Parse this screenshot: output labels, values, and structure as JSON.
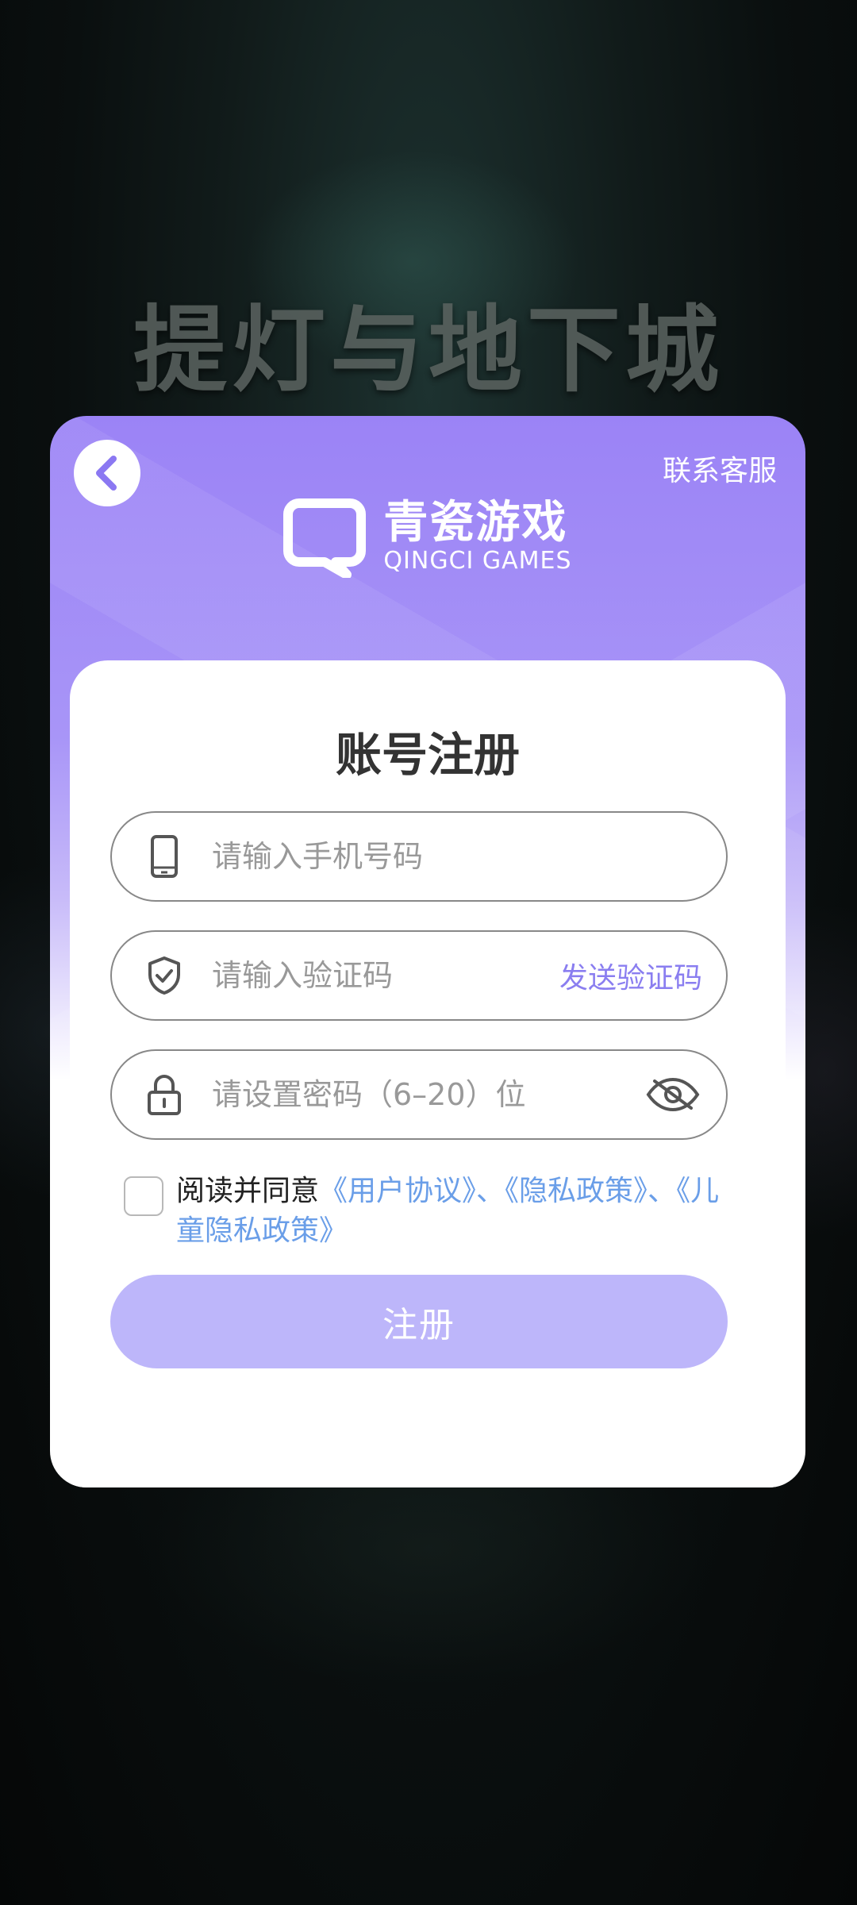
{
  "game_title": "提灯与地下城",
  "header": {
    "support_label": "联系客服",
    "brand_cn": "青瓷游戏",
    "brand_en": "QINGCI GAMES"
  },
  "form": {
    "title": "账号注册",
    "phone": {
      "placeholder": "请输入手机号码",
      "value": ""
    },
    "code": {
      "placeholder": "请输入验证码",
      "value": "",
      "send_label": "发送验证码"
    },
    "password": {
      "placeholder": "请设置密码（6–20）位",
      "value": ""
    },
    "agreement": {
      "prefix": "阅读并同意",
      "user_agreement": "《用户协议》",
      "separator1": "、",
      "privacy_policy": "《隐私政策》",
      "separator2": "、",
      "child_privacy": "《儿童隐私政策》",
      "checked": false
    },
    "submit_label": "注册"
  },
  "colors": {
    "accent": "#9b83f6",
    "link": "#6a9ee8",
    "send_code": "#8a7ef0",
    "button_disabled": "#bdb6fa"
  },
  "icons": [
    "back-arrow-icon",
    "qingci-logo-icon",
    "phone-icon",
    "shield-check-icon",
    "lock-icon",
    "eye-hidden-icon"
  ]
}
